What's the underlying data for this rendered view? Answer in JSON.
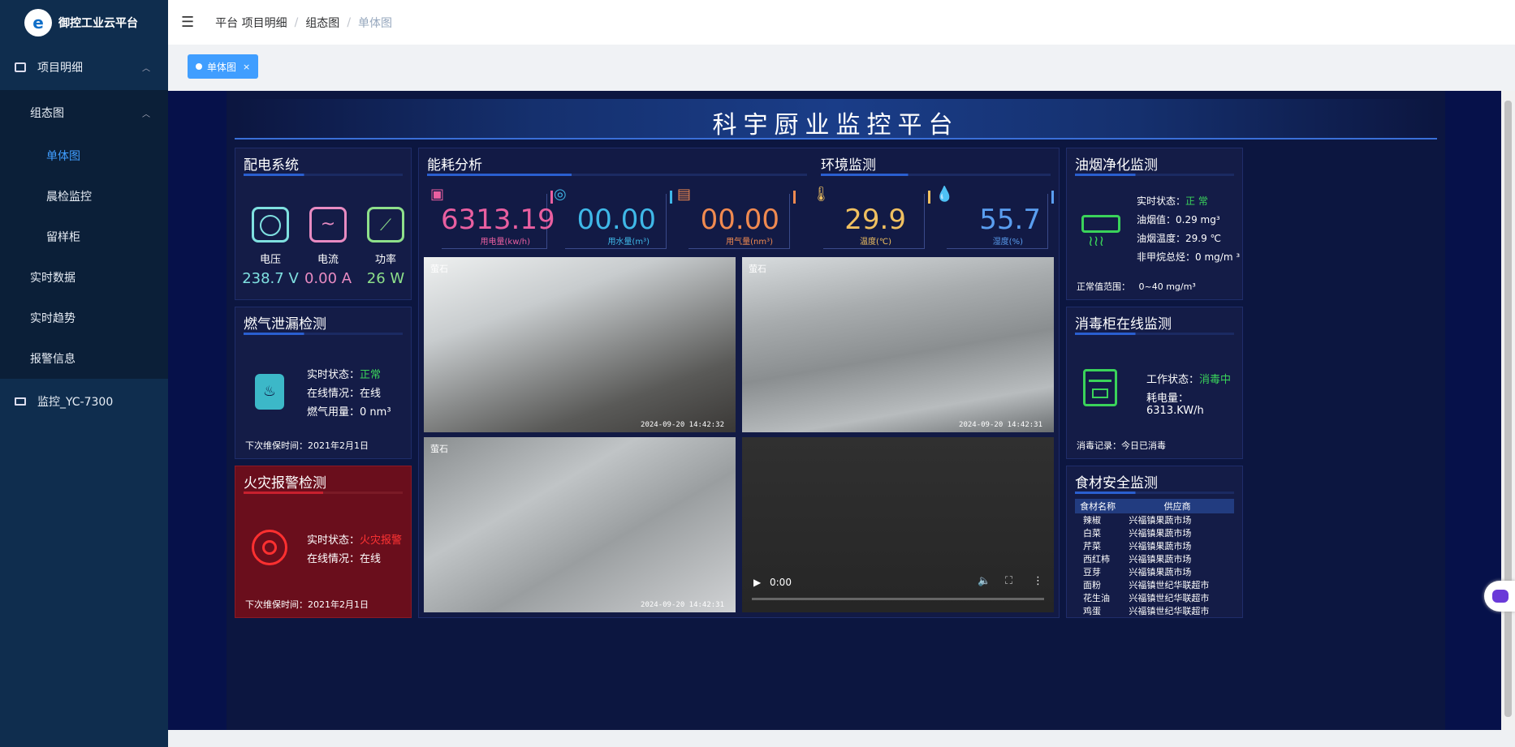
{
  "app": {
    "name": "御控工业云平台",
    "logo_glyph": "e"
  },
  "sidebar": {
    "items": [
      {
        "label": "项目明细"
      },
      {
        "label": "组态图"
      },
      {
        "label": "单体图"
      },
      {
        "label": "晨检监控"
      },
      {
        "label": "留样柜"
      },
      {
        "label": "实时数据"
      },
      {
        "label": "实时趋势"
      },
      {
        "label": "报警信息"
      },
      {
        "label": "监控_YC-7300"
      }
    ]
  },
  "header": {
    "breadcrumb": [
      "平台 项目明细",
      "组态图",
      "单体图"
    ],
    "sep": "/"
  },
  "tabs": [
    {
      "label": "单体图",
      "close": "×"
    }
  ],
  "dash": {
    "title": "科宇厨业监控平台",
    "power": {
      "title": "配电系统",
      "items": [
        {
          "label": "电压",
          "value": "238.7 V",
          "color": "#7fe0e0"
        },
        {
          "label": "电流",
          "value": "0.00 A",
          "color": "#e88bc2"
        },
        {
          "label": "功率",
          "value": "26 W",
          "color": "#8ee08a"
        }
      ]
    },
    "energy": {
      "title": "能耗分析",
      "meters": [
        {
          "value": "6313.19",
          "label": "用电量(kw/h)",
          "color": "#e95fa0",
          "icon": "electricity-icon"
        },
        {
          "value": "00.00",
          "label": "用水量(m³)",
          "color": "#3fb8e8",
          "icon": "water-icon"
        },
        {
          "value": "00.00",
          "label": "用气量(nm³)",
          "color": "#f08a50",
          "icon": "gas-icon"
        }
      ]
    },
    "env": {
      "title": "环境监测",
      "meters": [
        {
          "value": "29.9",
          "label": "温度(℃)",
          "color": "#f0c060",
          "icon": "thermometer-icon"
        },
        {
          "value": "55.7",
          "label": "湿度(%)",
          "color": "#5a9ef0",
          "icon": "humidity-icon"
        }
      ]
    },
    "smoke": {
      "title": "油烟净化监测",
      "rows": [
        {
          "k": "实时状态：",
          "v": "正 常"
        },
        {
          "k": "油烟值：",
          "v": "0.29 mg³"
        },
        {
          "k": "油烟温度：",
          "v": "29.9 ℃"
        },
        {
          "k": "非甲烷总烃：",
          "v": "0     mg/m ³"
        }
      ],
      "range_label": "正常值范围：",
      "range": "0~40 mg/m³"
    },
    "gas": {
      "title": "燃气泄漏检测",
      "rows": [
        {
          "k": "实时状态：",
          "v": "正常"
        },
        {
          "k": "在线情况：",
          "v": "在线"
        },
        {
          "k": "燃气用量：",
          "v": "0      nm³"
        }
      ],
      "next": "下次维保时间：2021年2月1日"
    },
    "fire": {
      "title": "火灾报警检测",
      "rows": [
        {
          "k": "实时状态：",
          "v": "火灾报警"
        },
        {
          "k": "在线情况：",
          "v": "在线"
        }
      ],
      "next": "下次维保时间：2021年2月1日"
    },
    "disinfect": {
      "title": "消毒柜在线监测",
      "rows": [
        {
          "k": "工作状态：",
          "v": "消毒中"
        },
        {
          "k": "耗电量：",
          "v": "6313.KW/h"
        }
      ],
      "record": "消毒记录：今日已消毒"
    },
    "food": {
      "title": "食材安全监测",
      "headers": [
        "食材名称",
        "供应商"
      ],
      "rows": [
        [
          "辣椒",
          "兴福镇果蔬市场"
        ],
        [
          "白菜",
          "兴福镇果蔬市场"
        ],
        [
          "芹菜",
          "兴福镇果蔬市场"
        ],
        [
          "西红柿",
          "兴福镇果蔬市场"
        ],
        [
          "豆芽",
          "兴福镇果蔬市场"
        ],
        [
          "面粉",
          "兴福镇世纪华联超市"
        ],
        [
          "花生油",
          "兴福镇世纪华联超市"
        ],
        [
          "鸡蛋",
          "兴福镇世纪华联超市"
        ]
      ]
    },
    "cams": [
      {
        "brand": "萤石",
        "time": "2024-09-20 14:42:32"
      },
      {
        "brand": "萤石",
        "time": "2024-09-20 14:42:31"
      },
      {
        "brand": "萤石",
        "time": "2024-09-20 14:42:31"
      }
    ],
    "video": {
      "time": "0:00"
    }
  }
}
